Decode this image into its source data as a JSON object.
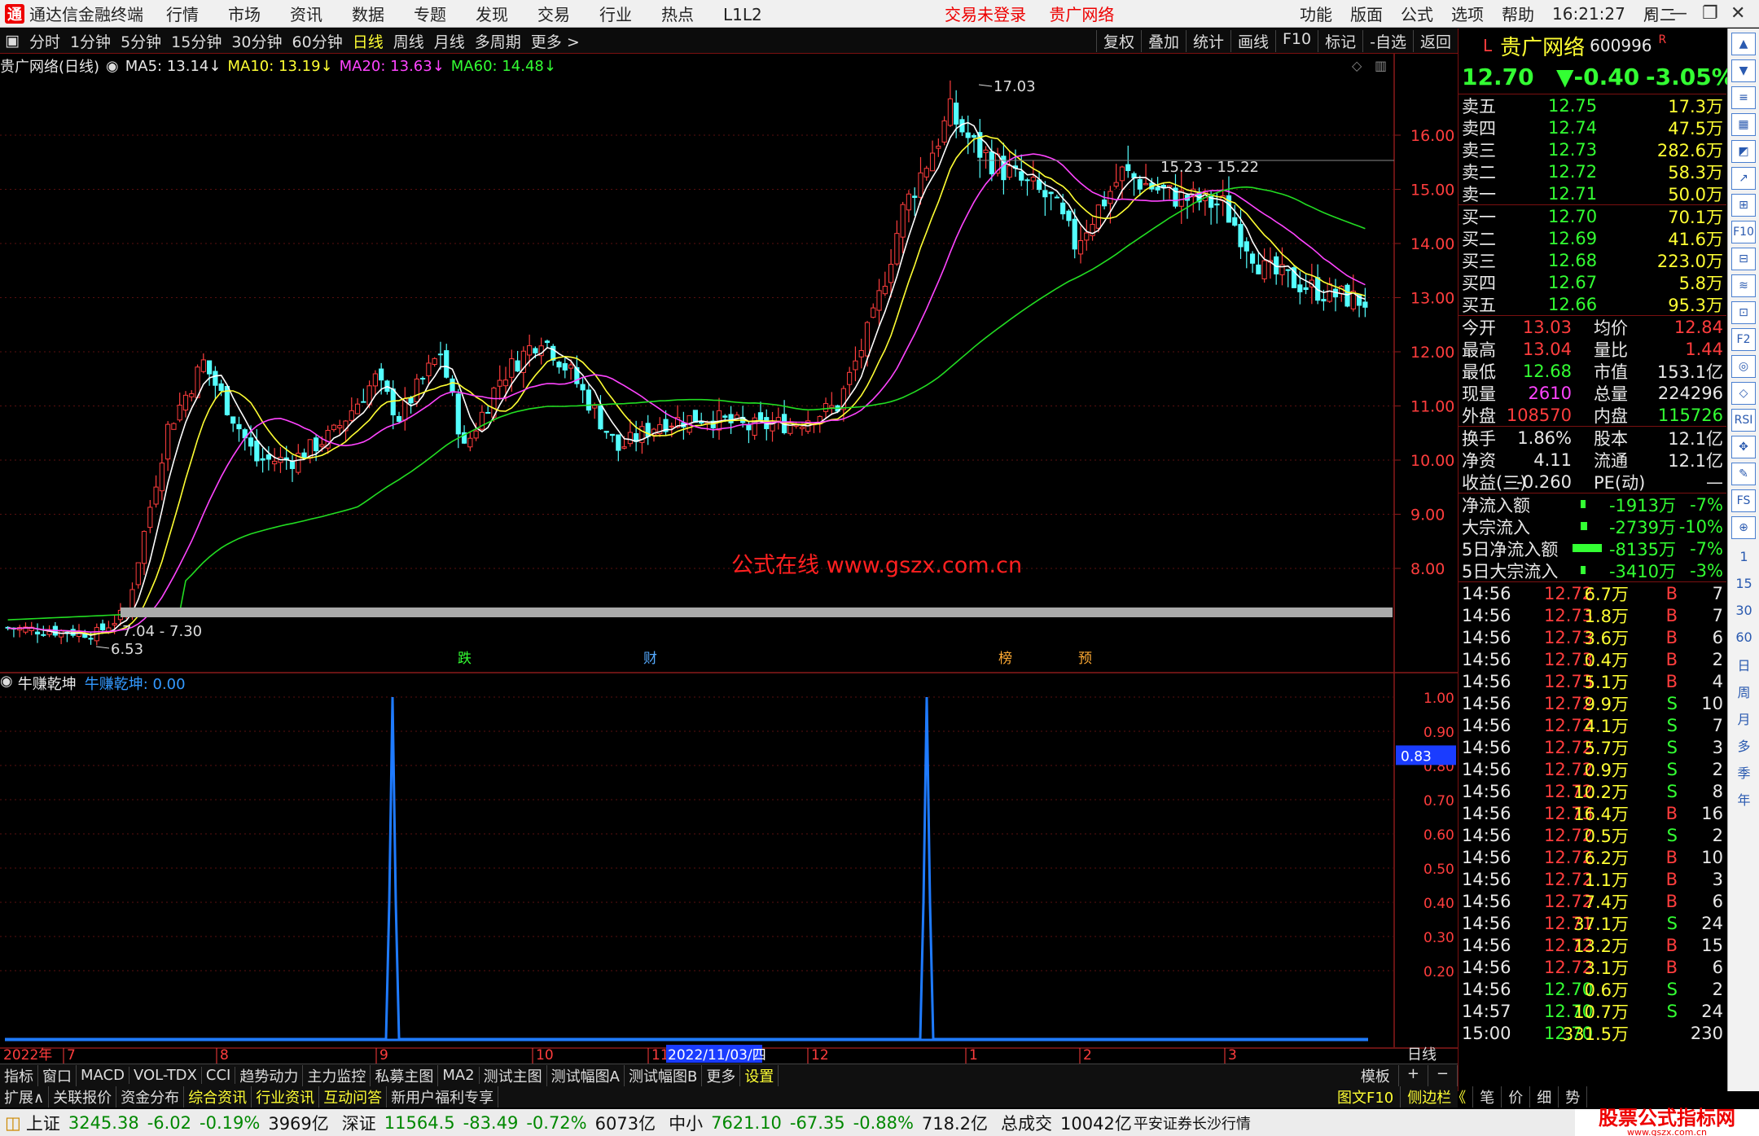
{
  "titlebar": {
    "app": "通达信金融终端",
    "menus": [
      "行情",
      "市场",
      "资讯",
      "数据",
      "专题",
      "发现",
      "交易",
      "行业",
      "热点",
      "L1L2"
    ],
    "trade_status": "交易未登录",
    "stock_name": "贵广网络",
    "right_menus": [
      "功能",
      "版面",
      "公式",
      "选项",
      "帮助"
    ],
    "time": "16:21:27",
    "weekday": "周二"
  },
  "toolbar": {
    "periods": [
      "分时",
      "1分钟",
      "5分钟",
      "15分钟",
      "30分钟",
      "60分钟",
      "日线",
      "周线",
      "月线",
      "多周期",
      "更多 >"
    ],
    "active": "日线",
    "tools": [
      "复权",
      "叠加",
      "统计",
      "画线",
      "F10",
      "标记",
      "-自选",
      "返回"
    ]
  },
  "kline": {
    "title": "贵广网络(日线)",
    "ma5": "MA5: 13.14↓",
    "ma10": "MA10: 13.19↓",
    "ma20": "MA20: 13.63↓",
    "ma60": "MA60: 14.48↓"
  },
  "chart_data": {
    "type": "candlestick",
    "ylim": [
      6.5,
      17.5
    ],
    "y_ticks": [
      "16.00",
      "15.00",
      "14.00",
      "13.00",
      "12.00",
      "11.00",
      "10.00",
      "9.00",
      "8.00"
    ],
    "high_label": "17.03",
    "low_label": "6.53",
    "range_label_high": "15.23 - 15.22",
    "range_label_low": "7.04 - 7.30",
    "event_markers": [
      "跌",
      "财",
      "榜",
      "预"
    ],
    "watermark": "公式在线  www.gszx.com.cn",
    "x_labels": [
      "2022年",
      "7",
      "8",
      "9",
      "10",
      "11",
      "2022/11/03/四",
      "12",
      "1",
      "2",
      "3"
    ],
    "x_unit": "日线",
    "oscillator": {
      "name": "牛赚乾坤",
      "value_label": "牛赚乾坤: 0.00",
      "ylim": [
        0,
        1.05
      ],
      "y_ticks": [
        "1.00",
        "0.90",
        "0.80",
        "0.70",
        "0.60",
        "0.50",
        "0.40",
        "0.30",
        "0.20"
      ],
      "cursor_value": "0.83",
      "spikes": [
        0.26,
        0.63
      ]
    }
  },
  "quote": {
    "name": "贵广网络",
    "code": "600996",
    "flag": "R",
    "price": "12.70",
    "change": "▼-0.40",
    "pct": "-3.05%",
    "asks": [
      {
        "l": "卖五",
        "p": "12.75",
        "v": "17.3万"
      },
      {
        "l": "卖四",
        "p": "12.74",
        "v": "47.5万"
      },
      {
        "l": "卖三",
        "p": "12.73",
        "v": "282.6万"
      },
      {
        "l": "卖二",
        "p": "12.72",
        "v": "58.3万"
      },
      {
        "l": "卖一",
        "p": "12.71",
        "v": "50.0万"
      }
    ],
    "bids": [
      {
        "l": "买一",
        "p": "12.70",
        "v": "70.1万"
      },
      {
        "l": "买二",
        "p": "12.69",
        "v": "41.6万"
      },
      {
        "l": "买三",
        "p": "12.68",
        "v": "223.0万"
      },
      {
        "l": "买四",
        "p": "12.67",
        "v": "5.8万"
      },
      {
        "l": "买五",
        "p": "12.66",
        "v": "95.3万"
      }
    ],
    "stats": [
      [
        "今开",
        "13.03",
        "均价",
        "12.84"
      ],
      [
        "最高",
        "13.04",
        "量比",
        "1.44"
      ],
      [
        "最低",
        "12.68",
        "市值",
        "153.1亿"
      ],
      [
        "现量",
        "2610",
        "总量",
        "224296"
      ],
      [
        "外盘",
        "108570",
        "内盘",
        "115726"
      ]
    ],
    "stats2": [
      [
        "换手",
        "1.86%",
        "股本",
        "12.1亿"
      ],
      [
        "净资",
        "4.11",
        "流通",
        "12.1亿"
      ],
      [
        "收益(三)",
        "-0.260",
        "PE(动)",
        "—"
      ]
    ],
    "flows": [
      [
        "净流入额",
        "-1913万",
        "-7%"
      ],
      [
        "大宗流入",
        "-2739万",
        "-10%"
      ],
      [
        "5日净流入额",
        "-8135万",
        "-7%"
      ],
      [
        "5日大宗流入",
        "-3410万",
        "-3%"
      ]
    ],
    "ticks": [
      [
        "14:56",
        "12.72",
        "6.7万",
        "B",
        "7"
      ],
      [
        "14:56",
        "12.73",
        "1.8万",
        "B",
        "7"
      ],
      [
        "14:56",
        "12.73",
        "3.6万",
        "B",
        "6"
      ],
      [
        "14:56",
        "12.73",
        "0.4万",
        "B",
        "2"
      ],
      [
        "14:56",
        "12.73",
        "5.1万",
        "B",
        "4"
      ],
      [
        "14:56",
        "12.72",
        "9.9万",
        "S",
        "10"
      ],
      [
        "14:56",
        "12.72",
        "4.1万",
        "S",
        "7"
      ],
      [
        "14:56",
        "12.72",
        "5.7万",
        "S",
        "3"
      ],
      [
        "14:56",
        "12.72",
        "0.9万",
        "S",
        "2"
      ],
      [
        "14:56",
        "12.72",
        "10.2万",
        "S",
        "8"
      ],
      [
        "14:56",
        "12.73",
        "16.4万",
        "B",
        "16"
      ],
      [
        "14:56",
        "12.72",
        "0.5万",
        "S",
        "2"
      ],
      [
        "14:56",
        "12.72",
        "6.2万",
        "B",
        "10"
      ],
      [
        "14:56",
        "12.72",
        "1.1万",
        "B",
        "3"
      ],
      [
        "14:56",
        "12.72",
        "7.4万",
        "B",
        "6"
      ],
      [
        "14:56",
        "12.71",
        "37.1万",
        "S",
        "24"
      ],
      [
        "14:56",
        "12.72",
        "13.2万",
        "B",
        "15"
      ],
      [
        "14:56",
        "12.72",
        "3.1万",
        "B",
        "6"
      ],
      [
        "14:56",
        "12.70",
        "0.6万",
        "S",
        "2"
      ],
      [
        "14:57",
        "12.70",
        "10.7万",
        "S",
        "24"
      ],
      [
        "15:00",
        "12.70",
        "331.5万",
        "",
        "230"
      ]
    ]
  },
  "bottom_tabs": [
    "指标",
    "窗口",
    "MACD",
    "VOL-TDX",
    "CCI",
    "趋势动力",
    "主力监控",
    "私募主图",
    "MA2",
    "测试主图",
    "测试幅图A",
    "测试幅图B",
    "更多",
    "设置"
  ],
  "bottom_right": [
    "模板",
    "+",
    "−"
  ],
  "ext_tabs": [
    "扩展∧",
    "关联报价",
    "资金分布",
    "综合资讯",
    "行业资讯",
    "互动问答",
    "新用户福利专享"
  ],
  "ext_right": [
    "图文F10",
    "侧边栏《",
    "笔",
    "价",
    "细",
    "势"
  ],
  "side_icons": [
    "▲",
    "▼",
    "≡",
    "▦",
    "◩",
    "↗",
    "⊞",
    "F10",
    "⊟",
    "≋",
    "⊡",
    "F2",
    "◎",
    "◇",
    "RSI",
    "✥",
    "✎",
    "FS",
    "⊕",
    "1",
    "15",
    "30",
    "60",
    "日",
    "周",
    "月",
    "多",
    "季",
    "年"
  ],
  "status": {
    "indices": [
      {
        "name": "上证",
        "val": "3245.38",
        "chg": "-6.02",
        "pct": "-0.19%",
        "amt": "3969亿"
      },
      {
        "name": "深证",
        "val": "11564.5",
        "chg": "-83.49",
        "pct": "-0.72%",
        "amt": "6073亿"
      },
      {
        "name": "中小",
        "val": "7621.10",
        "chg": "-67.35",
        "pct": "-0.88%",
        "amt": "718.2亿"
      }
    ],
    "total_label": "总成交",
    "total": "10042亿",
    "broker": "平安证券长沙行情",
    "site_logo": "股票公式指标网",
    "site_url": "www.gszx.com.cn"
  }
}
